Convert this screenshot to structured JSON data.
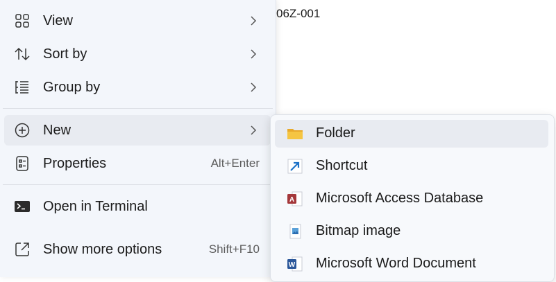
{
  "background": {
    "filename_fragment": "06Z-001"
  },
  "context_menu": {
    "items": [
      {
        "label": "View",
        "icon": "grid-icon",
        "has_submenu": true
      },
      {
        "label": "Sort by",
        "icon": "sort-icon",
        "has_submenu": true
      },
      {
        "label": "Group by",
        "icon": "group-list-icon",
        "has_submenu": true
      },
      {
        "label": "New",
        "icon": "plus-circle-icon",
        "has_submenu": true,
        "highlighted": true
      },
      {
        "label": "Properties",
        "icon": "properties-icon",
        "shortcut": "Alt+Enter"
      },
      {
        "label": "Open in Terminal",
        "icon": "terminal-icon"
      },
      {
        "label": "Show more options",
        "icon": "share-out-icon",
        "shortcut": "Shift+F10"
      }
    ]
  },
  "new_submenu": {
    "items": [
      {
        "label": "Folder",
        "icon": "folder-icon",
        "highlighted": true
      },
      {
        "label": "Shortcut",
        "icon": "shortcut-arrow-icon"
      },
      {
        "label": "Microsoft Access Database",
        "icon": "access-db-icon"
      },
      {
        "label": "Bitmap image",
        "icon": "bitmap-image-icon"
      },
      {
        "label": "Microsoft Word Document",
        "icon": "word-doc-icon"
      }
    ]
  },
  "colors": {
    "menu_bg": "#f3f6fb",
    "hover_bg": "#e8ebf1",
    "folder_yellow": "#f5c542",
    "shortcut_blue": "#1e73c8",
    "access_red": "#a4373a",
    "word_blue": "#2b579a"
  }
}
